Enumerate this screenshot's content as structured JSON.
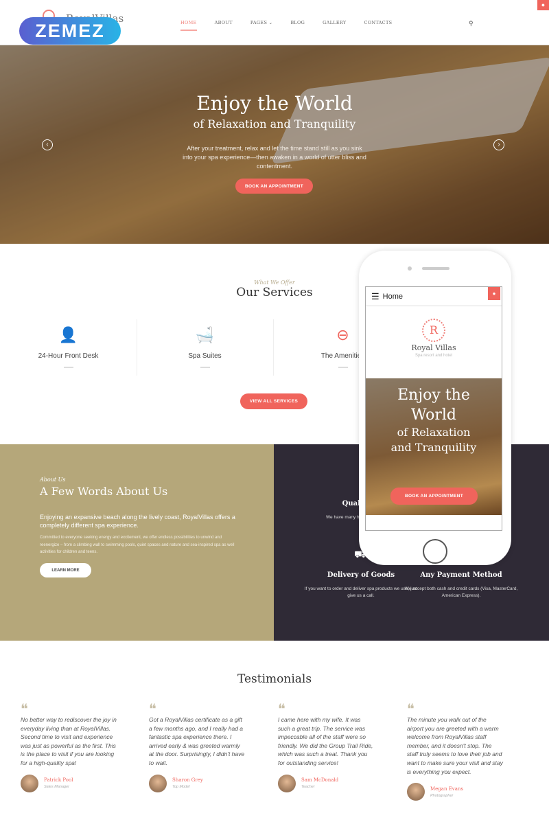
{
  "header": {
    "logo_text": "RoyalVillas",
    "badge": "ZEMEZ",
    "nav": [
      {
        "label": "HOME",
        "active": true
      },
      {
        "label": "ABOUT"
      },
      {
        "label": "PAGES ⌄"
      },
      {
        "label": "BLOG"
      },
      {
        "label": "GALLERY"
      },
      {
        "label": "CONTACTS"
      }
    ],
    "search_icon": "search-icon",
    "user_icon": "user-icon"
  },
  "hero": {
    "title": "Enjoy the World",
    "subtitle": "of Relaxation and Tranquility",
    "text": "After your treatment, relax and let the time stand still as you sink into your spa experience—then awaken in a world of utter bliss and contentment.",
    "button": "BOOK AN APPOINTMENT",
    "prev": "‹",
    "next": "›"
  },
  "services": {
    "kicker": "What We Offer",
    "title": "Our Services",
    "items": [
      {
        "label": "24-Hour Front Desk",
        "icon": "receptionist-icon"
      },
      {
        "label": "Spa Suites",
        "icon": "bathtub-icon"
      },
      {
        "label": "The Amenities",
        "icon": "door-hanger-icon"
      }
    ],
    "button": "VIEW ALL SERVICES"
  },
  "about": {
    "kicker": "About Us",
    "title": "A Few Words About Us",
    "lead": "Enjoying an expansive beach along the lively coast, RoyalVillas offers a completely different spa experience.",
    "text": "Committed to everyone seeking energy and excitement, we offer endless possibilities to unwind and reenergize – from a climbing wall to swimming pools, quiet spaces and nature and sea-inspired spa as well activities for children and teens.",
    "button": "LEARN MORE"
  },
  "features": [
    {
      "title": "Qualified",
      "text": "We have many highly help you re"
    },
    {
      "title": "Delivery of Goods",
      "text": "If you want to order and deliver spa products we use, just give us a call."
    },
    {
      "title": "Any Payment Method",
      "text": "We accept both cash and credit cards (Visa, MasterCard, American Express)."
    }
  ],
  "testimonials": {
    "title": "Testimonials",
    "items": [
      {
        "quote": "No better way to rediscover the joy in everyday living than at RoyalVillas. Second time to visit and experience was just as powerful as the first. This is the place to visit if you are looking for a high-quality spa!",
        "name": "Patrick Pool",
        "role": "Sales Manager"
      },
      {
        "quote": "Got a RoyalVillas certificate as a gift a few months ago, and I really had a fantastic spa experience there. I arrived early & was greeted warmly at the door. Surprisingly, I didn't have to wait.",
        "name": "Sharon Grey",
        "role": "Top Model"
      },
      {
        "quote": "I came here with my wife. It was such a great trip. The service was impeccable all of the staff were so friendly. We did the Group Trail Ride, which was such a treat. Thank you for outstanding service!",
        "name": "Sam McDonald",
        "role": "Teacher"
      },
      {
        "quote": "The minute you walk out of the airport you are greeted with a warm welcome from RoyalVillas staff member, and it doesn't stop. The staff truly seems to love their job and want to make sure your visit and stay is everything you expect.",
        "name": "Megan Evans",
        "role": "Photographer"
      }
    ]
  },
  "phone": {
    "menu": "Home",
    "logo_letter": "R",
    "brand": "Royal Villas",
    "tagline": "Spa resort and hotel",
    "title": "Enjoy the World",
    "subtitle": "of Relaxation and Tranquility",
    "button": "BOOK AN APPOINTMENT"
  },
  "colors": {
    "accent": "#f0645c",
    "about_bg": "#b5a77a",
    "features_bg": "#2f2a36"
  }
}
